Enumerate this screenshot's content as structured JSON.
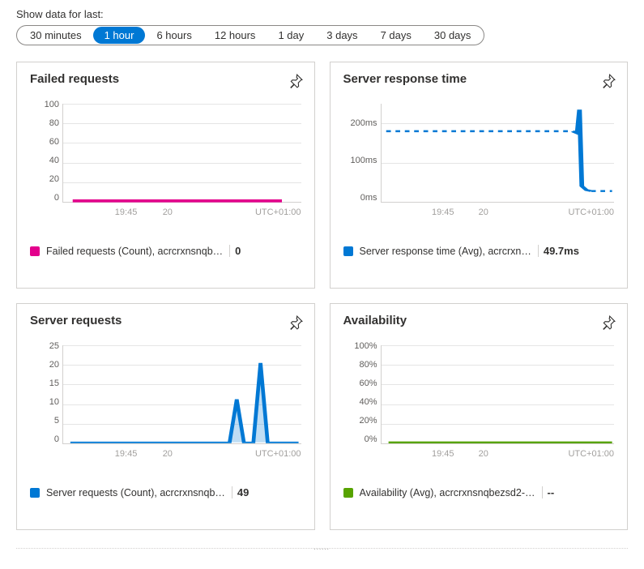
{
  "timeSelector": {
    "label": "Show data for last:",
    "options": [
      "30 minutes",
      "1 hour",
      "6 hours",
      "12 hours",
      "1 day",
      "3 days",
      "7 days",
      "30 days"
    ],
    "selectedIndex": 1
  },
  "timezone": "UTC+01:00",
  "xTicks": [
    "19:45",
    "20"
  ],
  "cards": [
    {
      "title": "Failed requests",
      "legend": "Failed requests (Count), acrcrxnsnqb…",
      "value": "0",
      "color": "#e3008c"
    },
    {
      "title": "Server response time",
      "legend": "Server response time (Avg), acrcrxn…",
      "value": "49.7ms",
      "color": "#0078d4"
    },
    {
      "title": "Server requests",
      "legend": "Server requests (Count), acrcrxnsnqb…",
      "value": "49",
      "color": "#0078d4"
    },
    {
      "title": "Availability",
      "legend": "Availability (Avg), acrcrxnsnqbezsd2-…",
      "value": "--",
      "color": "#57a300"
    }
  ],
  "chart_data": [
    {
      "type": "line",
      "title": "Failed requests",
      "ylabel": "Count",
      "y_ticks": [
        0,
        20,
        40,
        60,
        80,
        100
      ],
      "ylim": [
        0,
        100
      ],
      "x_labels": [
        "19:45",
        "20"
      ],
      "series": [
        {
          "name": "Failed requests (Count)",
          "summary_value": 0,
          "flat_at": 0
        }
      ]
    },
    {
      "type": "line",
      "title": "Server response time",
      "ylabel": "ms",
      "y_ticks": [
        "0ms",
        "100ms",
        "200ms"
      ],
      "ylim": [
        0,
        220
      ],
      "x_labels": [
        "19:45",
        "20"
      ],
      "series": [
        {
          "name": "Server response time (Avg)",
          "summary_value": "49.7ms",
          "segments": [
            {
              "style": "dotted",
              "from_x": 0,
              "to_x": 0.82,
              "y": 180
            },
            {
              "style": "solid",
              "points": [
                [
                  0.82,
                  180
                ],
                [
                  0.84,
                  175
                ],
                [
                  0.85,
                  214
                ],
                [
                  0.86,
                  40
                ],
                [
                  0.88,
                  30
                ],
                [
                  0.9,
                  28
                ]
              ]
            },
            {
              "style": "dotted",
              "from_x": 0.9,
              "to_x": 1.0,
              "y": 28
            }
          ]
        }
      ]
    },
    {
      "type": "area",
      "title": "Server requests",
      "ylabel": "Count",
      "y_ticks": [
        0,
        5,
        10,
        15,
        20,
        25
      ],
      "ylim": [
        0,
        27
      ],
      "x_labels": [
        "19:45",
        "20"
      ],
      "series": [
        {
          "name": "Server requests (Count)",
          "summary_value": 49,
          "points_xy": [
            [
              0,
              0
            ],
            [
              0.7,
              0
            ],
            [
              0.73,
              12
            ],
            [
              0.76,
              0
            ],
            [
              0.8,
              0
            ],
            [
              0.83,
              22
            ],
            [
              0.86,
              0
            ],
            [
              1,
              0
            ]
          ]
        }
      ]
    },
    {
      "type": "line",
      "title": "Availability",
      "ylabel": "%",
      "y_ticks": [
        "0%",
        "20%",
        "40%",
        "60%",
        "80%",
        "100%"
      ],
      "ylim": [
        0,
        100
      ],
      "x_labels": [
        "19:45",
        "20"
      ],
      "series": [
        {
          "name": "Availability (Avg)",
          "summary_value": "--",
          "flat_at": 0
        }
      ]
    }
  ]
}
